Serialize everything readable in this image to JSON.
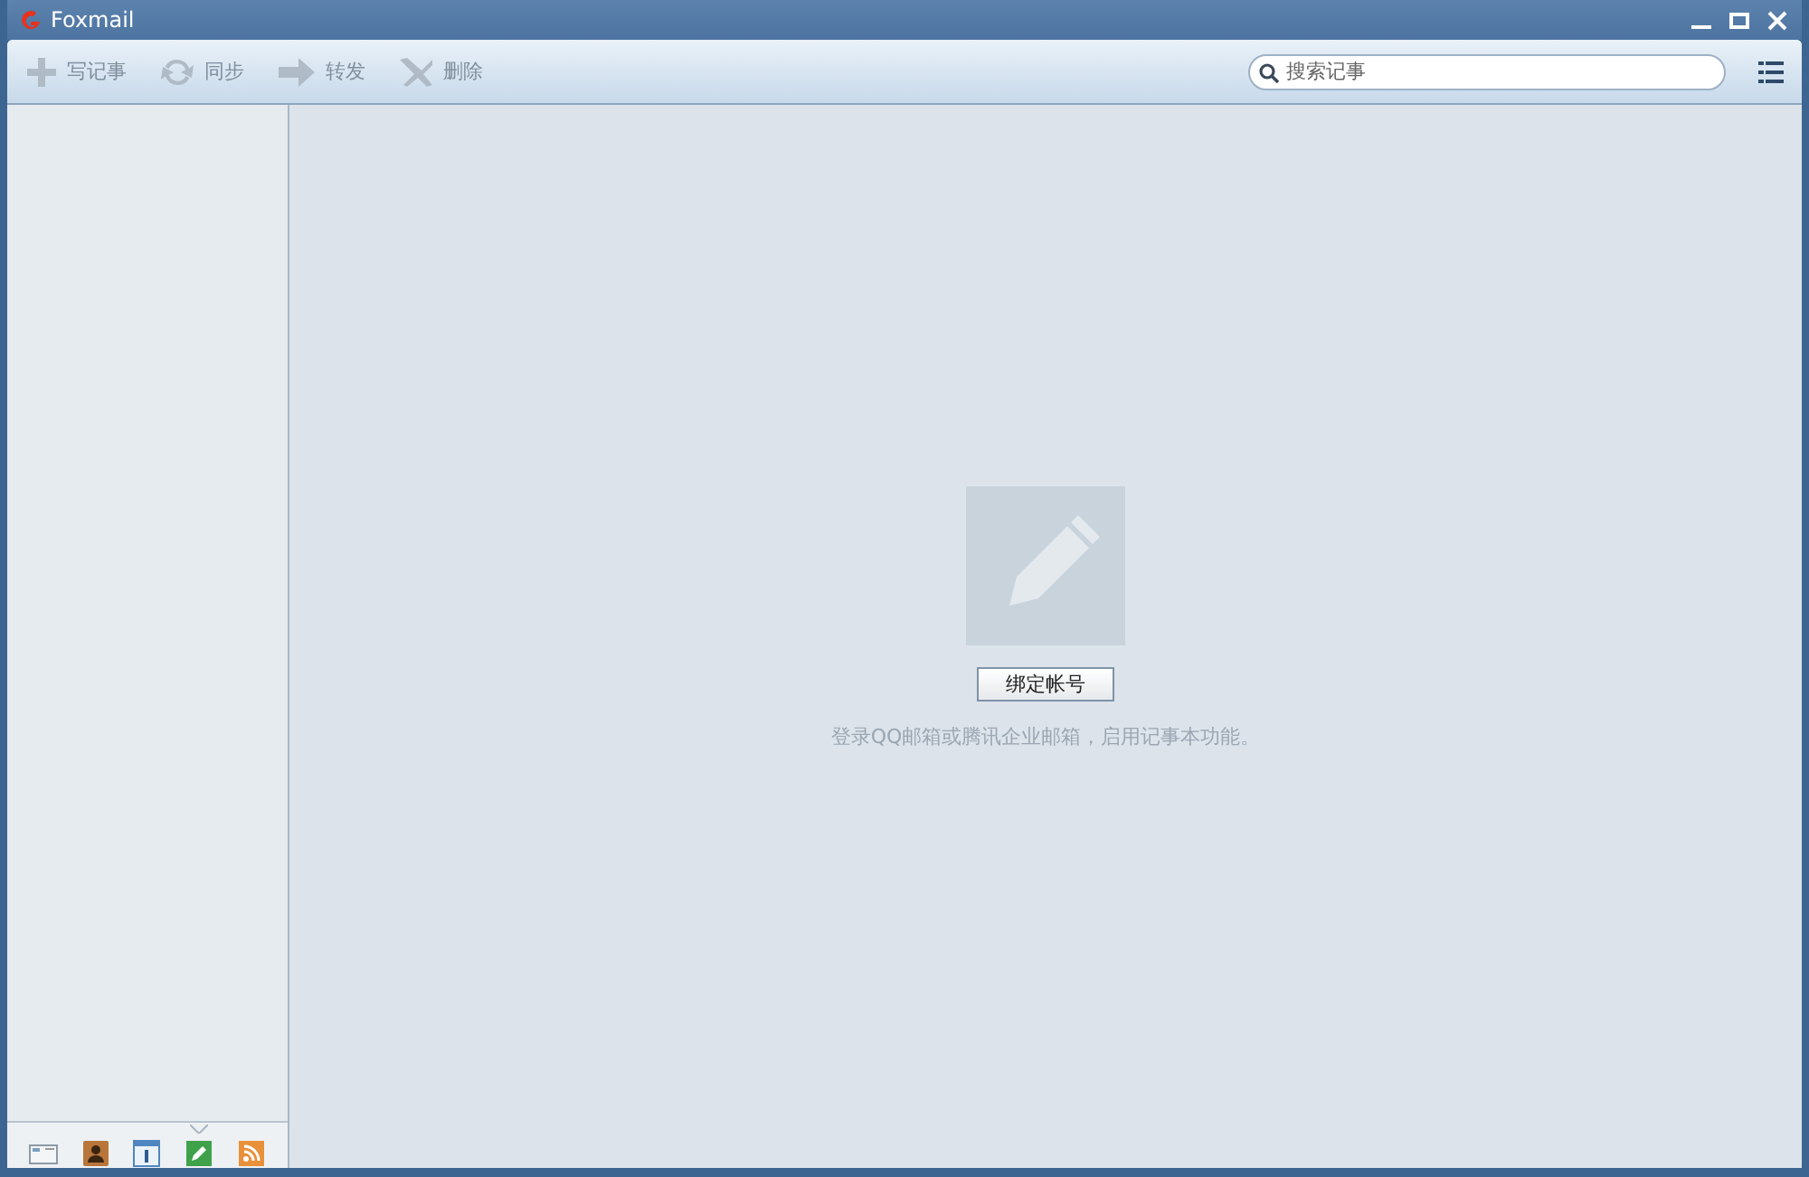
{
  "window": {
    "title": "Foxmail"
  },
  "toolbar": {
    "buttons": [
      {
        "kind": "new",
        "label": "写记事",
        "disabled": true
      },
      {
        "kind": "sync",
        "label": "同步",
        "disabled": true
      },
      {
        "kind": "forward",
        "label": "转发",
        "disabled": true
      },
      {
        "kind": "delete",
        "label": "删除",
        "disabled": true
      }
    ],
    "search": {
      "placeholder": "搜索记事"
    }
  },
  "empty_state": {
    "button": "绑定帐号",
    "message": "登录QQ邮箱或腾讯企业邮箱，启用记事本功能。"
  },
  "nav": [
    {
      "kind": "mail",
      "selected": false
    },
    {
      "kind": "contacts",
      "selected": false
    },
    {
      "kind": "calendar",
      "selected": false
    },
    {
      "kind": "notes",
      "selected": true
    },
    {
      "kind": "feeds",
      "selected": false
    }
  ]
}
